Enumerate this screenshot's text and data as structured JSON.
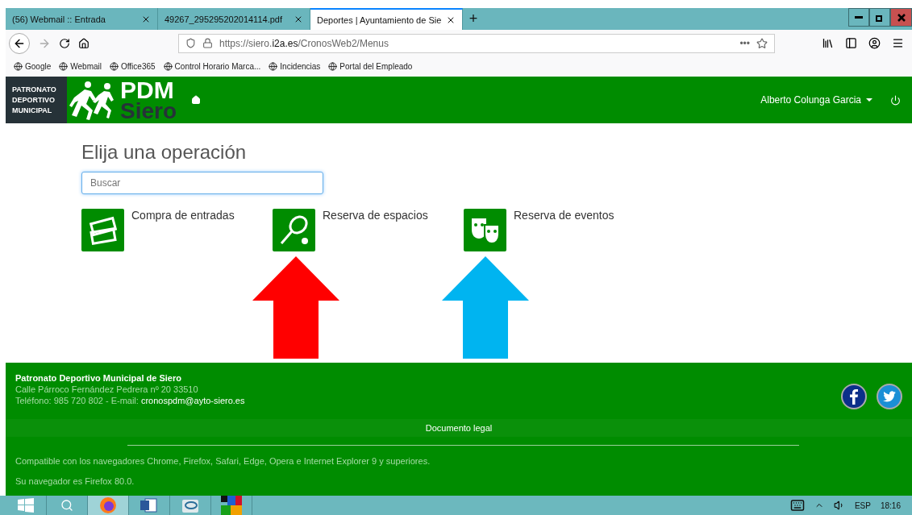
{
  "browser": {
    "tabs": [
      {
        "label": "(56) Webmail :: Entrada",
        "selected": false
      },
      {
        "label": "49267_295295202014114.pdf",
        "selected": false
      },
      {
        "label": "Deportes | Ayuntamiento de Sie",
        "selected": true
      }
    ],
    "new_tab": "+",
    "url_host": "https://siero.",
    "url_domain": "i2a.es",
    "url_path": "/CronosWeb2/Menus",
    "url_more": "•••",
    "bookmarks": [
      "Google",
      "Webmail",
      "Office365",
      "Control Horario Marca...",
      "Incidencias",
      "Portal del Empleado"
    ]
  },
  "header": {
    "logo_lines": [
      "PATRONATO",
      "DEPORTIVO",
      "MUNICIPAL"
    ],
    "brand_top": "PDM",
    "brand_bottom": "Siero",
    "user": "Alberto Colunga Garcia"
  },
  "page": {
    "title": "Elija una operación",
    "search": {
      "placeholder": "Buscar"
    },
    "operations": [
      {
        "label": "Compra de entradas",
        "kind": "tickets"
      },
      {
        "label": "Reserva de espacios",
        "kind": "tennis"
      },
      {
        "label": "Reserva de eventos",
        "kind": "theatre"
      }
    ],
    "annotations": [
      {
        "color": "#ff0000"
      },
      {
        "color": "#00b4f0"
      }
    ]
  },
  "footer": {
    "org": "Patronato Deportivo Municipal de Siero",
    "address": "Calle Párroco Fernández Pedrera nº 20 33510",
    "phone": "Teléfono: 985 720 802 - E-mail:",
    "email": "cronospdm@ayto-siero.es",
    "legal": "Documento legal",
    "compat": "Compatible con los navegadores Chrome, Firefox, Safari, Edge, Opera e Internet Explorer 9 y superiores.",
    "browser_note": "Su navegador es Firefox 80.0."
  },
  "taskbar": {
    "lang": "ESP",
    "time": "18:16"
  }
}
